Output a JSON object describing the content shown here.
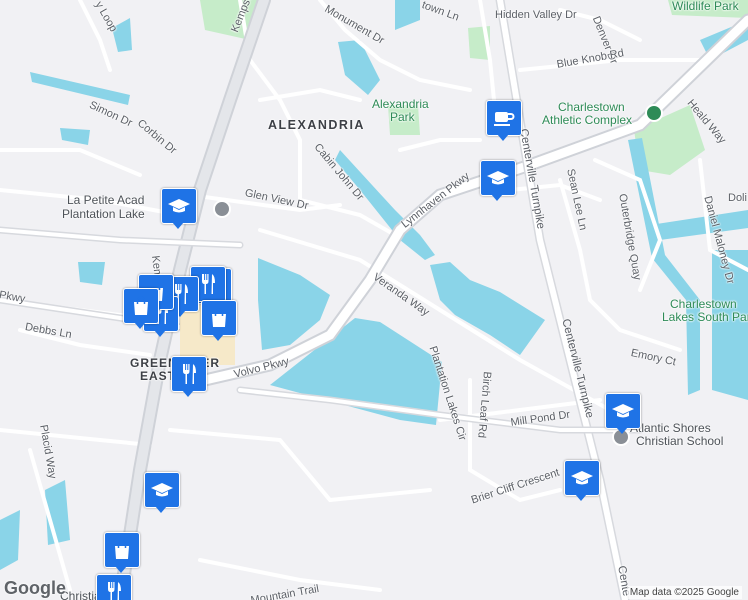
{
  "area_labels": {
    "alexandria": "ALEXANDRIA",
    "greenbrier_1": "GREENBRIER",
    "greenbrier_2": "EAST"
  },
  "roads": {
    "kempsville_rd": "Kempsville Rd",
    "kempsville_rd_lower": "Kempsville Rd",
    "monument_dr": "Monument Dr",
    "hidden_valley": "Hidden Valley Dr",
    "town_ln": "town Ln",
    "denver_dr": "Denver Dr",
    "blue_knob_rd": "Blue Knob Rd",
    "simon_dr": "Simon Dr",
    "corbin_dr": "Corbin Dr",
    "cabin_john_dr": "Cabin John Dr",
    "glen_view_dr": "Glen View Dr",
    "lynnhaven_pkwy": "Lynnhaven Pkwy",
    "veranda_way": "Veranda Way",
    "volvo_pkwy": "Volvo Pkwy",
    "debbs_ln": "Debbs Ln",
    "pkwy_left": "Pkwy",
    "plantation_lakes_cir": "Plantation Lakes Cir",
    "birch_leaf_rd": "Birch Leaf Rd",
    "mill_pond_dr": "Mill Pond Dr",
    "brier_cliff_crescent": "Brier Cliff Crescent",
    "centerville_tpk_1": "Centerville Turnpike",
    "centerville_tpk_2": "Centerville Turnpike",
    "centerville_tpk_3": "Cente",
    "sean_lee_ln": "Sean Lee Ln",
    "outerbridge_quay": "Outerbridge Quay",
    "daniel_maloney_dr": "Daniel Maloney Dr",
    "emory_ct": "Emory Ct",
    "heald_way": "Heald Way",
    "doli": "Doli",
    "placid_way": "Placid Way",
    "mountain_trail": "Mountain Trail",
    "y_loop": "y Loop"
  },
  "places": {
    "alexandria_park_1": "Alexandria",
    "alexandria_park_2": "Park",
    "charlestown_1": "Charlestown",
    "charlestown_2": "Athletic Complex",
    "wildlife_park": "Wildlife Park",
    "charlestown_lakes_1": "Charlestown",
    "charlestown_lakes_2": "Lakes South Par",
    "la_petite_1": "La Petite Acad",
    "la_petite_2": "Plantation Lake",
    "atlantic_shores_1": "Atlantic Shores",
    "atlantic_shores_2": "Christian School",
    "christia": "Christia"
  },
  "pins": [
    {
      "name": "cafe",
      "icon": "coffee-cup-icon"
    },
    {
      "name": "school-lynnhaven",
      "icon": "graduation-cap-icon"
    },
    {
      "name": "school-la-petite",
      "icon": "graduation-cap-icon"
    },
    {
      "name": "school-atlantic-shores",
      "icon": "graduation-cap-icon"
    },
    {
      "name": "school-centerville",
      "icon": "graduation-cap-icon"
    },
    {
      "name": "school-kempsville-south",
      "icon": "graduation-cap-icon"
    },
    {
      "name": "restaurant-1",
      "icon": "fork-knife-icon"
    },
    {
      "name": "restaurant-2",
      "icon": "fork-knife-icon"
    },
    {
      "name": "restaurant-3",
      "icon": "fork-knife-icon"
    },
    {
      "name": "restaurant-4",
      "icon": "fork-knife-icon"
    },
    {
      "name": "restaurant-5",
      "icon": "fork-knife-icon"
    },
    {
      "name": "shopping-1",
      "icon": "shopping-bag-icon"
    },
    {
      "name": "shopping-2",
      "icon": "shopping-bag-icon"
    },
    {
      "name": "shopping-3",
      "icon": "shopping-bag-icon"
    }
  ],
  "attribution": {
    "logo": "Google",
    "map_data": "Map data ©2025 Google"
  },
  "colors": {
    "water": "#8ad4e8",
    "park": "#c6ecc9",
    "pin": "#1f73e6",
    "land": "#f1f1f4",
    "road": "#ffffff",
    "highway": "#dfe1e5"
  }
}
